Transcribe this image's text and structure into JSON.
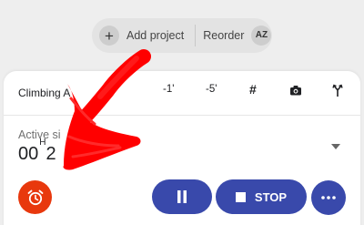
{
  "top_bar": {
    "add_project": {
      "icon": "plus-icon",
      "label": "Add project"
    },
    "reorder": {
      "label": "Reorder",
      "icon": "az-sort-icon",
      "icon_text": "AZ"
    }
  },
  "card": {
    "project_name": "Climbing A",
    "tools": {
      "minus_one": "-1'",
      "minus_five": "-5'",
      "tag_icon": "hash-icon",
      "tag_text": "#",
      "camera_icon": "camera-icon",
      "branch_icon": "branch-icon"
    },
    "active_label": "Active si",
    "timer": {
      "value": "00",
      "unit": "H",
      "partial": "2"
    },
    "dropdown_icon": "chevron-down-icon",
    "actions": {
      "alarm_icon": "alarm-icon",
      "pause_icon": "pause-icon",
      "stop_label": "STOP",
      "more_icon": "more-horizontal-icon"
    }
  },
  "colors": {
    "accent": "#3949ab",
    "alarm": "#e8380d",
    "annotation": "#ff0000",
    "background": "#eeeeee",
    "card": "#ffffff"
  },
  "annotation": {
    "type": "arrow",
    "icon": "red-arrow-annotation"
  }
}
